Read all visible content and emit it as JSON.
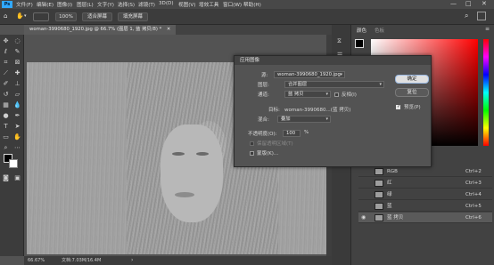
{
  "menubar": {
    "logo": "Ps",
    "items": [
      "文件(F)",
      "编辑(E)",
      "图像(I)",
      "图层(L)",
      "文字(Y)",
      "选择(S)",
      "滤镜(T)",
      "3D(D)",
      "视图(V)",
      "增效工具",
      "窗口(W)",
      "帮助(H)"
    ],
    "min": "—",
    "restore": "□",
    "close": "✕"
  },
  "options": {
    "zoom_value": "100%",
    "fit_screen": "适合屏幕",
    "fill_screen": "填充屏幕"
  },
  "document": {
    "tab_title": "woman-3990680_1920.jpg @ 66.7% (图层 1, 蓝 拷贝/8) *",
    "tab_close": "✕"
  },
  "status": {
    "zoom": "66.67%",
    "info": "文档:7.03M/16.4M"
  },
  "panels": {
    "color_tab": "颜色",
    "swatches_tab": "色板",
    "channels": [
      {
        "name": "RGB",
        "shortcut": "Ctrl+2"
      },
      {
        "name": "红",
        "shortcut": "Ctrl+3"
      },
      {
        "name": "绿",
        "shortcut": "Ctrl+4"
      },
      {
        "name": "蓝",
        "shortcut": "Ctrl+5"
      },
      {
        "name": "蓝 拷贝",
        "shortcut": "Ctrl+6"
      }
    ]
  },
  "dialog": {
    "title": "应用图像",
    "source_label": "源:",
    "source_value": "woman-3990680_1920.jpg",
    "layer_label": "图层:",
    "layer_value": "合并图层",
    "channel_label": "通道:",
    "channel_value": "蓝 拷贝",
    "invert_label": "反相(I)",
    "target_label": "目标:",
    "target_value": "woman-3990680...(蓝 拷贝)",
    "blending_label": "混合:",
    "blending_value": "叠加",
    "opacity_label": "不透明度(O):",
    "opacity_value": "100",
    "opacity_unit": "%",
    "preserve_label": "保留透明区域(T)",
    "mask_label": "蒙版(K)...",
    "ok_button": "确定",
    "reset_button": "复位",
    "preview_label": "预览(P)"
  }
}
